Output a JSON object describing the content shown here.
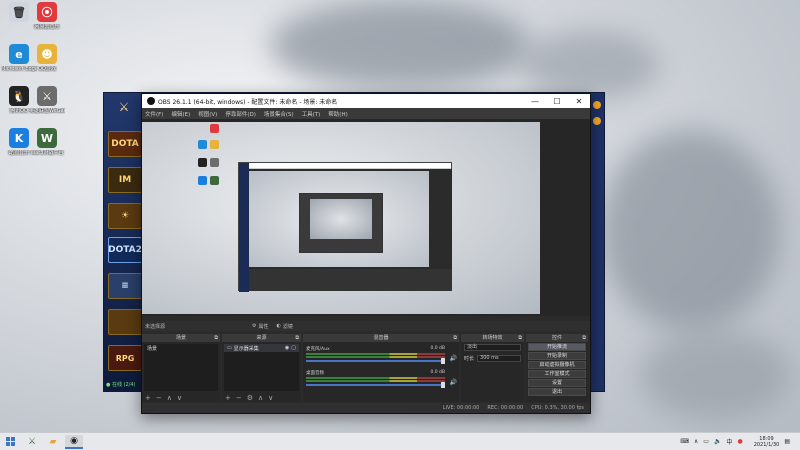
{
  "desktop": {
    "icons": [
      {
        "label": "",
        "color": "#cfd5df",
        "glyph": "🗑"
      },
      {
        "label": "网易云音乐",
        "color": "#e03a3e",
        "glyph": "⦿"
      },
      {
        "label": "Microsoft Edge",
        "color": "#1f8ad6",
        "glyph": "e"
      },
      {
        "label": "QQ游戏",
        "color": "#e7b33a",
        "glyph": "☻"
      },
      {
        "label": "腾讯QQ",
        "color": "#222222",
        "glyph": "🐧"
      },
      {
        "label": "英雄联盟WeGame版",
        "color": "#6c6c6c",
        "glyph": "⚔"
      },
      {
        "label": "酷狗音乐",
        "color": "#1b7fe0",
        "glyph": "K"
      },
      {
        "label": "War3对战平台",
        "color": "#3c6a3c",
        "glyph": "W"
      }
    ]
  },
  "launcher": {
    "tiles": [
      "DOTA",
      "IM",
      "☀",
      "DOTA2",
      "≡",
      "",
      "RPG"
    ],
    "status": "● 在线 (2/4)"
  },
  "obs": {
    "title": "OBS 26.1.1 (64-bit, windows) - 配置文件: 未命名 - 场景: 未命名",
    "menu": [
      "文件(F)",
      "编辑(E)",
      "视图(V)",
      "停靠部件(D)",
      "场景集合(S)",
      "工具(T)",
      "帮助(H)"
    ],
    "source_toolbar": {
      "no_selection": "未选择源",
      "properties": "属性",
      "filters": "滤镜"
    },
    "docks": {
      "scenes": {
        "title": "场景",
        "items": [
          "场景"
        ]
      },
      "sources": {
        "title": "来源",
        "items": [
          "显示器采集"
        ]
      },
      "mixer": {
        "title": "混音器",
        "tracks": [
          {
            "name": "麦克风/Aux",
            "level": "0.0 dB"
          },
          {
            "name": "桌面音频",
            "level": "0.0 dB"
          }
        ]
      },
      "transitions": {
        "title": "转场特效",
        "type": "淡出",
        "duration_label": "时长",
        "duration_value": "300 ms"
      },
      "controls": {
        "title": "控件",
        "buttons": [
          "开始推流",
          "开始录制",
          "启动虚拟摄像机",
          "工作室模式",
          "设置",
          "退出"
        ]
      }
    },
    "status": {
      "live": "LIVE: 00:00:00",
      "rec": "REC: 00:00:00",
      "cpu": "CPU: 0.3%, 30.00 fps"
    }
  },
  "taskbar": {
    "time": "18:09",
    "date": "2021/1/30",
    "ime": "中"
  }
}
